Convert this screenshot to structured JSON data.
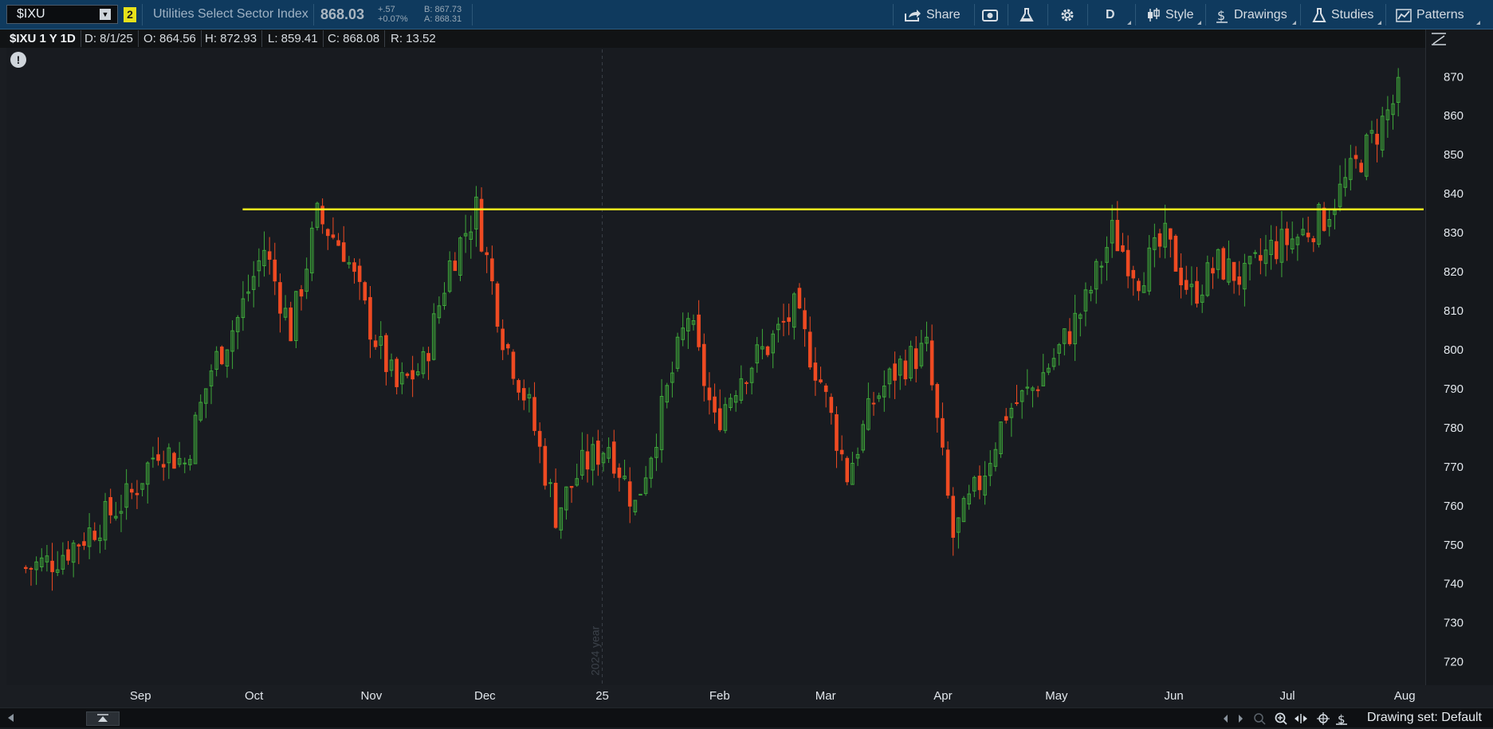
{
  "toolbar": {
    "symbol": "$IXU",
    "link_badge": "2",
    "description": "Utilities Select Sector Index",
    "last": "868.03",
    "change": "+.57",
    "change_pct": "+0.07%",
    "bid": "B: 867.73",
    "ask": "A: 868.31",
    "share_label": "Share",
    "aggregation_label": "D",
    "style_label": "Style",
    "drawings_label": "Drawings",
    "studies_label": "Studies",
    "patterns_label": "Patterns"
  },
  "infobar": {
    "title": "$IXU 1 Y 1D",
    "date": "D: 8/1/25",
    "open": "O: 864.56",
    "high": "H: 872.93",
    "low": "L: 859.41",
    "close": "C: 868.08",
    "range": "R: 13.52"
  },
  "footer": {
    "drawing_set": "Drawing set: Default"
  },
  "colors": {
    "up": "#3ea83a",
    "down": "#ee4a22",
    "level_line": "#f2ee1d",
    "background": "#181b20"
  },
  "chart_data": {
    "type": "candlestick",
    "title": "",
    "xlabel": "",
    "ylabel": "",
    "x_ticks": [
      "Sep",
      "Oct",
      "Nov",
      "Dec",
      "25",
      "Feb",
      "Mar",
      "Apr",
      "May",
      "Jun",
      "Jul",
      "Aug"
    ],
    "y_ticks": [
      720,
      730,
      740,
      750,
      760,
      770,
      780,
      790,
      800,
      810,
      820,
      830,
      840,
      850,
      860,
      870
    ],
    "ylim": [
      714,
      877
    ],
    "year_divider_label": "2024 year",
    "horizontal_level": 836,
    "grid": false,
    "series": [
      {
        "date": "2024-08-01",
        "close": 744
      },
      {
        "date": "2024-08-08",
        "close": 746
      },
      {
        "date": "2024-08-15",
        "close": 751
      },
      {
        "date": "2024-08-22",
        "close": 757
      },
      {
        "date": "2024-08-29",
        "close": 763
      },
      {
        "date": "2024-09-05",
        "close": 775
      },
      {
        "date": "2024-09-12",
        "close": 771
      },
      {
        "date": "2024-09-19",
        "close": 795
      },
      {
        "date": "2024-09-26",
        "close": 808
      },
      {
        "date": "2024-10-03",
        "close": 826
      },
      {
        "date": "2024-10-10",
        "close": 805
      },
      {
        "date": "2024-10-17",
        "close": 834
      },
      {
        "date": "2024-10-24",
        "close": 826
      },
      {
        "date": "2024-10-31",
        "close": 806
      },
      {
        "date": "2024-11-07",
        "close": 790
      },
      {
        "date": "2024-11-14",
        "close": 796
      },
      {
        "date": "2024-11-21",
        "close": 822
      },
      {
        "date": "2024-11-28",
        "close": 836
      },
      {
        "date": "2024-12-05",
        "close": 804
      },
      {
        "date": "2024-12-12",
        "close": 785
      },
      {
        "date": "2024-12-19",
        "close": 758
      },
      {
        "date": "2024-12-26",
        "close": 770
      },
      {
        "date": "2025-01-02",
        "close": 776
      },
      {
        "date": "2025-01-09",
        "close": 760
      },
      {
        "date": "2025-01-16",
        "close": 784
      },
      {
        "date": "2025-01-23",
        "close": 809
      },
      {
        "date": "2025-01-30",
        "close": 781
      },
      {
        "date": "2025-02-06",
        "close": 794
      },
      {
        "date": "2025-02-13",
        "close": 801
      },
      {
        "date": "2025-02-20",
        "close": 810
      },
      {
        "date": "2025-02-27",
        "close": 792
      },
      {
        "date": "2025-03-06",
        "close": 768
      },
      {
        "date": "2025-03-13",
        "close": 787
      },
      {
        "date": "2025-03-20",
        "close": 796
      },
      {
        "date": "2025-03-27",
        "close": 800
      },
      {
        "date": "2025-04-03",
        "close": 752
      },
      {
        "date": "2025-04-10",
        "close": 766
      },
      {
        "date": "2025-04-17",
        "close": 784
      },
      {
        "date": "2025-04-24",
        "close": 790
      },
      {
        "date": "2025-05-01",
        "close": 800
      },
      {
        "date": "2025-05-08",
        "close": 812
      },
      {
        "date": "2025-05-15",
        "close": 830
      },
      {
        "date": "2025-05-22",
        "close": 819
      },
      {
        "date": "2025-05-29",
        "close": 828
      },
      {
        "date": "2025-06-05",
        "close": 814
      },
      {
        "date": "2025-06-12",
        "close": 822
      },
      {
        "date": "2025-06-19",
        "close": 818
      },
      {
        "date": "2025-06-26",
        "close": 826
      },
      {
        "date": "2025-07-03",
        "close": 829
      },
      {
        "date": "2025-07-10",
        "close": 834
      },
      {
        "date": "2025-07-17",
        "close": 845
      },
      {
        "date": "2025-07-24",
        "close": 856
      },
      {
        "date": "2025-07-31",
        "close": 868
      }
    ]
  }
}
